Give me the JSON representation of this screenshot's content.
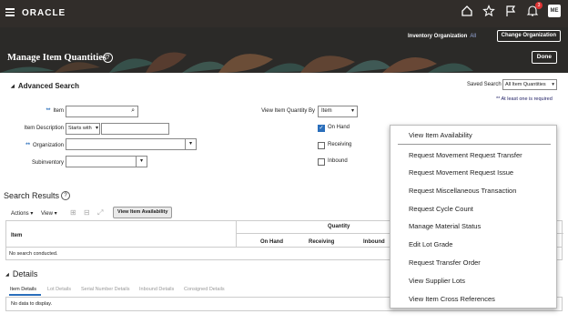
{
  "app": {
    "brand": "ORACLE",
    "notification_count": "3",
    "avatar_initials": "ME"
  },
  "header": {
    "inventory_org_label": "Inventory Organization",
    "inventory_org_value": "All",
    "change_org_button": "Change Organization",
    "page_title": "Manage Item Quantities",
    "done_button": "Done"
  },
  "advanced_search": {
    "title": "Advanced Search",
    "saved_search_label": "Saved Search",
    "saved_search_value": "All Item Quantities",
    "required_note": "** At least one is required",
    "item_label": "Item",
    "item_value": "",
    "item_description_label": "Item Description",
    "item_description_operator": "Starts with",
    "item_description_value": "",
    "organization_label": "Organization",
    "organization_value": "",
    "subinventory_label": "Subinventory",
    "subinventory_value": "",
    "view_by_label": "View Item Quantity By",
    "view_by_value": "Item",
    "on_hand_label": "On Hand",
    "on_hand_checked": true,
    "receiving_label": "Receiving",
    "inbound_label": "Inbound"
  },
  "results": {
    "title": "Search Results",
    "actions_label": "Actions",
    "view_label": "View",
    "view_item_availability_button": "View Item Availability",
    "col_item": "Item",
    "col_quantity": "Quantity",
    "col_on_hand": "On Hand",
    "col_receiving": "Receiving",
    "col_inbound": "Inbound",
    "empty_message": "No search conducted."
  },
  "details": {
    "title": "Details",
    "tabs": [
      "Item Details",
      "Lot Details",
      "Serial Number Details",
      "Inbound Details",
      "Consigned Details"
    ],
    "empty_message": "No data to display."
  },
  "menu": {
    "items": [
      "View Item Availability",
      "Request Movement Request Transfer",
      "Request Movement Request Issue",
      "Request Miscellaneous Transaction",
      "Request Cycle Count",
      "Manage Material Status",
      "Edit Lot Grade",
      "Request Transfer Order",
      "View Supplier Lots",
      "View Item Cross References"
    ]
  },
  "colors": {
    "topbar": "#312d2a",
    "banner": "#2b2a28",
    "accent": "#2a6ebb"
  }
}
